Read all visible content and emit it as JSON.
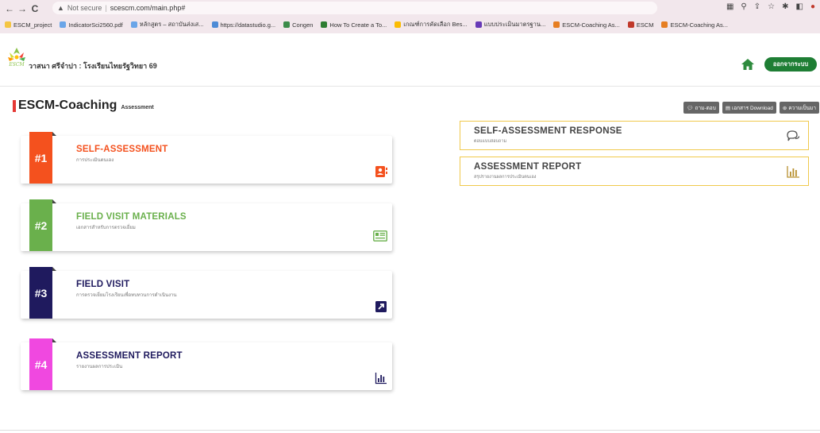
{
  "browser": {
    "back": "←",
    "forward": "→",
    "reload": "C",
    "security_label": "Not secure",
    "url": "scescm.com/main.php#",
    "bookmarks": [
      {
        "label": "ESCM_project",
        "color": "#f4c542"
      },
      {
        "label": "IndicatorSci2560.pdf",
        "color": "#6aa5e8"
      },
      {
        "label": "หลักสูตร – สถาบันส่งเส...",
        "color": "#6aa5e8"
      },
      {
        "label": "https://datastudio.g...",
        "color": "#4d8bd6"
      },
      {
        "label": "Congen",
        "color": "#3c8c4a"
      },
      {
        "label": "How To Create a To...",
        "color": "#2e7d32"
      },
      {
        "label": "เกณฑ์การคัดเลือก Bes...",
        "color": "#fbbc04"
      },
      {
        "label": "แบบประเมินมาตรฐาน...",
        "color": "#673ab7"
      },
      {
        "label": "ESCM-Coaching As...",
        "color": "#e67e22"
      },
      {
        "label": "ESCM",
        "color": "#c0392b"
      },
      {
        "label": "ESCM-Coaching As...",
        "color": "#e67e22"
      }
    ]
  },
  "header": {
    "school_name": "วาสนา ศรีจำปา : โรงเรียนไทยรัฐวิทยา 69",
    "logout_label": "ออกจากระบบ"
  },
  "page": {
    "title": "ESCM-Coaching",
    "subtitle": "Assessment",
    "buttons": [
      {
        "icon": "chat-icon",
        "label": "ถาม-ตอบ"
      },
      {
        "icon": "document-icon",
        "label": "เอกสาร Download"
      },
      {
        "icon": "info-icon",
        "label": "ความเป็นมา"
      }
    ]
  },
  "cards": [
    {
      "num": "#1",
      "title": "SELF-ASSESSMENT",
      "subtitle": "การประเมินตนเอง",
      "color": "#f4511e",
      "title_color": "#f4511e",
      "icon": "contact-card-icon"
    },
    {
      "num": "#2",
      "title": "FIELD VISIT MATERIALS",
      "subtitle": "เอกสารสำหรับการตรวจเยี่ยม",
      "color": "#6ab04c",
      "title_color": "#6ab04c",
      "icon": "newspaper-icon"
    },
    {
      "num": "#3",
      "title": "FIELD VISIT",
      "subtitle": "การตรวจเยี่ยมโรงเรียนเพื่อทบทวนการดำเนินงาน",
      "color": "#1f1a5e",
      "title_color": "#1f1a5e",
      "icon": "external-link-icon"
    },
    {
      "num": "#4",
      "title": "ASSESSMENT REPORT",
      "subtitle": "รายงานผลการประเมิน",
      "color": "#f048e0",
      "title_color": "#1f1a5e",
      "icon": "bar-chart-icon"
    }
  ],
  "panels": [
    {
      "title": "SELF-ASSESSMENT RESPONSE",
      "subtitle": "ตอบแบบสอบถาม",
      "icon": "chat-bubbles-icon"
    },
    {
      "title": "ASSESSMENT REPORT",
      "subtitle": "สรุปรายงานผลการประเมินตนเอง",
      "icon": "bar-chart-icon"
    }
  ]
}
